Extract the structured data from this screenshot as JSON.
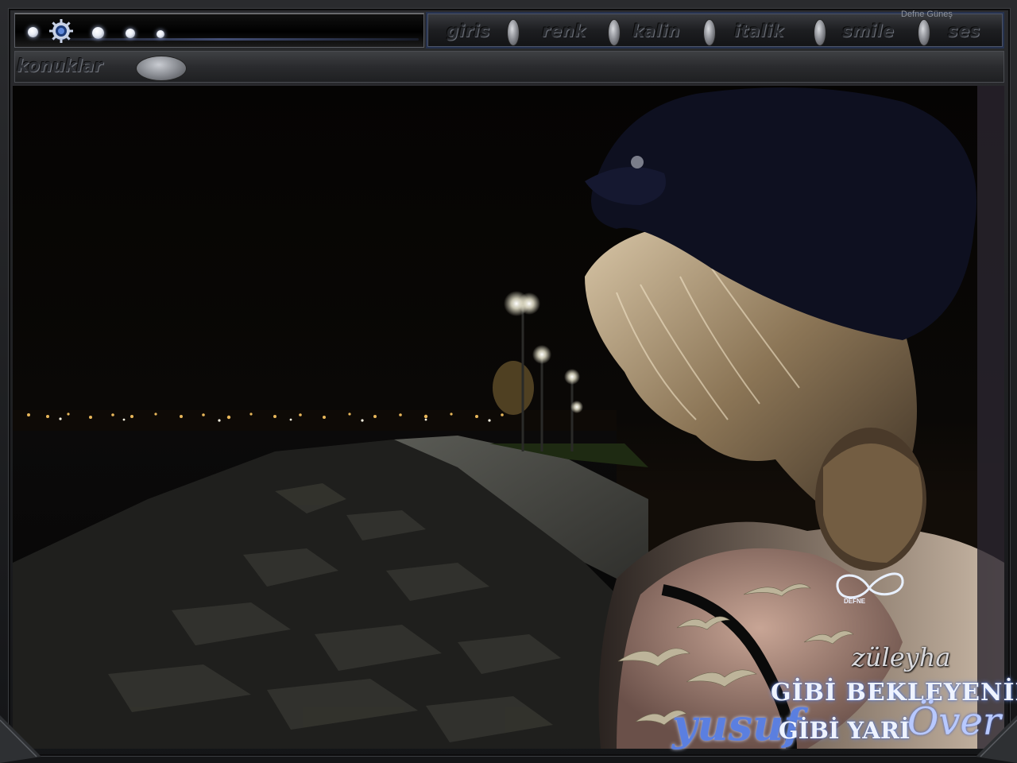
{
  "header": {
    "menu": [
      {
        "label": "GIRIS"
      },
      {
        "label": "RENK"
      },
      {
        "label": "KALIN"
      },
      {
        "label": "ITALIK"
      },
      {
        "label": "SMILE"
      },
      {
        "label": "SES"
      }
    ],
    "user_name": "Defne Güneş"
  },
  "toolbar": {
    "section_label": "KONUKLAR"
  },
  "scene": {
    "icons": [
      "gear-icon",
      "light-dot",
      "bird"
    ],
    "badge_text": "DEFNE",
    "signature": "züleyha",
    "caption_line1": "GİBİ BEKLEYENİN",
    "script_word": "yusuf",
    "caption_line2": "GİBİ YARİ",
    "script_end": "Över",
    "accent_color": "#5b7fe0"
  }
}
